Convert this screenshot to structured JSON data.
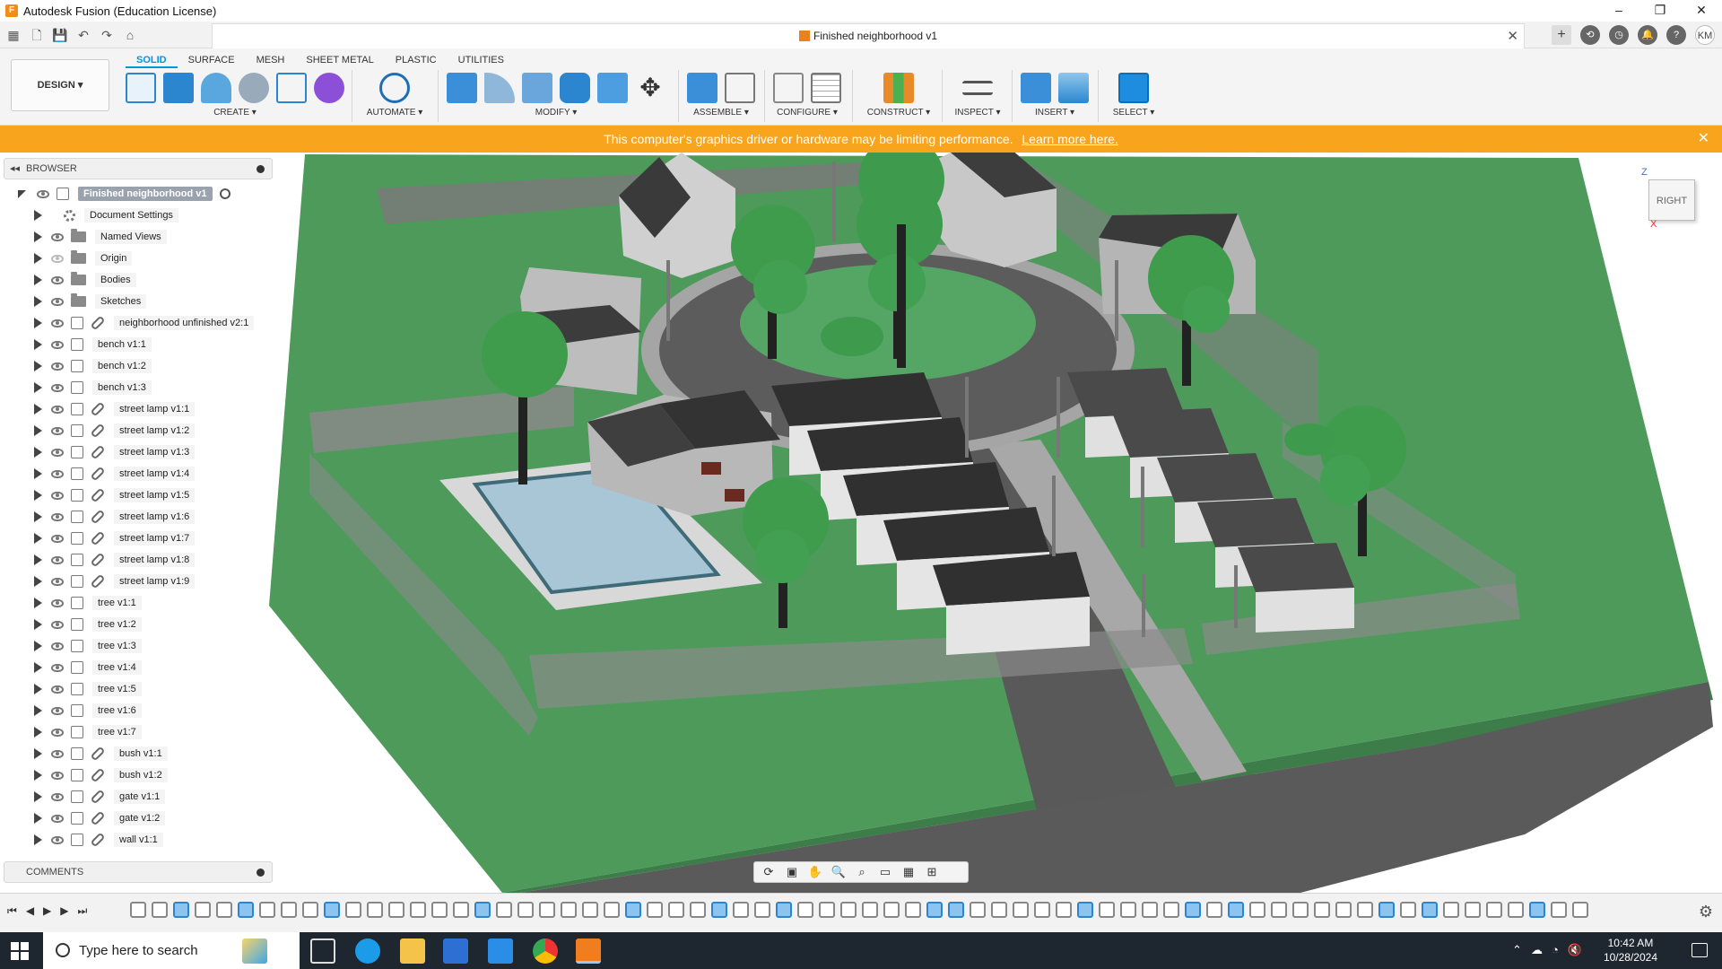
{
  "window": {
    "title": "Autodesk Fusion (Education License)",
    "minimize": "–",
    "maximize": "❐",
    "close": "✕"
  },
  "document": {
    "tab_title": "Finished neighborhood v1",
    "close": "✕"
  },
  "workspace_tabs": [
    "SOLID",
    "SURFACE",
    "MESH",
    "SHEET METAL",
    "PLASTIC",
    "UTILITIES"
  ],
  "active_tab": "SOLID",
  "workspace_button": "DESIGN ▾",
  "toolbar_groups": [
    {
      "label": "CREATE ▾"
    },
    {
      "label": "AUTOMATE ▾"
    },
    {
      "label": "MODIFY ▾"
    },
    {
      "label": "ASSEMBLE ▾"
    },
    {
      "label": "CONFIGURE ▾"
    },
    {
      "label": "CONSTRUCT ▾"
    },
    {
      "label": "INSPECT ▾"
    },
    {
      "label": "INSERT ▾"
    },
    {
      "label": "SELECT ▾"
    }
  ],
  "warning": {
    "message": "This computer's graphics driver or hardware may be limiting performance.",
    "link": "Learn more here.",
    "close": "✕"
  },
  "browser": {
    "header": "BROWSER",
    "root": "Finished neighborhood v1",
    "items": [
      {
        "label": "Document Settings",
        "kind": "settings"
      },
      {
        "label": "Named Views",
        "kind": "folder"
      },
      {
        "label": "Origin",
        "kind": "folder",
        "hidden": true
      },
      {
        "label": "Bodies",
        "kind": "folder"
      },
      {
        "label": "Sketches",
        "kind": "folder"
      },
      {
        "label": "neighborhood unfinished v2:1",
        "kind": "linked"
      },
      {
        "label": "bench v1:1",
        "kind": "component"
      },
      {
        "label": "bench v1:2",
        "kind": "component"
      },
      {
        "label": "bench v1:3",
        "kind": "component"
      },
      {
        "label": "street lamp v1:1",
        "kind": "linked"
      },
      {
        "label": "street lamp v1:2",
        "kind": "linked"
      },
      {
        "label": "street lamp v1:3",
        "kind": "linked"
      },
      {
        "label": "street lamp v1:4",
        "kind": "linked"
      },
      {
        "label": "street lamp v1:5",
        "kind": "linked"
      },
      {
        "label": "street lamp v1:6",
        "kind": "linked"
      },
      {
        "label": "street lamp v1:7",
        "kind": "linked"
      },
      {
        "label": "street lamp v1:8",
        "kind": "linked"
      },
      {
        "label": "street lamp v1:9",
        "kind": "linked"
      },
      {
        "label": "tree v1:1",
        "kind": "component"
      },
      {
        "label": "tree v1:2",
        "kind": "component"
      },
      {
        "label": "tree v1:3",
        "kind": "component"
      },
      {
        "label": "tree v1:4",
        "kind": "component"
      },
      {
        "label": "tree v1:5",
        "kind": "component"
      },
      {
        "label": "tree v1:6",
        "kind": "component"
      },
      {
        "label": "tree v1:7",
        "kind": "component"
      },
      {
        "label": "bush v1:1",
        "kind": "linked"
      },
      {
        "label": "bush v1:2",
        "kind": "linked"
      },
      {
        "label": "gate v1:1",
        "kind": "linked"
      },
      {
        "label": "gate v1:2",
        "kind": "linked"
      },
      {
        "label": "wall v1:1",
        "kind": "linked"
      }
    ]
  },
  "comments": {
    "header": "COMMENTS"
  },
  "viewcube": {
    "face": "RIGHT",
    "axis_z": "Z",
    "axis_x": "X"
  },
  "taskbar": {
    "search_placeholder": "Type here to search",
    "time": "10:42 AM",
    "date": "10/28/2024"
  },
  "colors": {
    "accent": "#0696d7",
    "warning": "#f8a41c",
    "grass": "#4a9a5a",
    "road": "#555555"
  }
}
